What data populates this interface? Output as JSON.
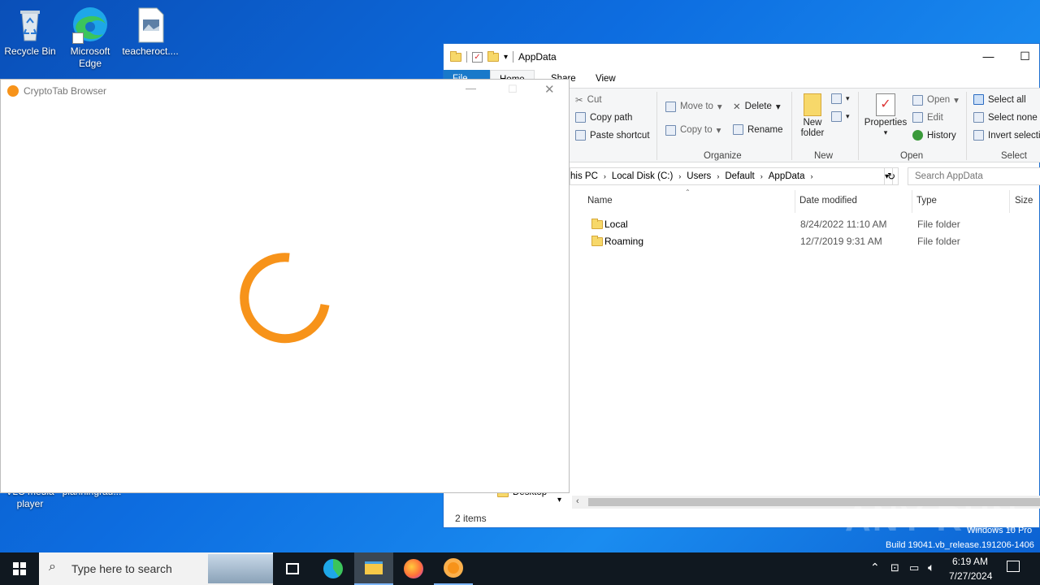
{
  "desktop": {
    "icons": [
      {
        "label": "Recycle Bin"
      },
      {
        "label": "Microsoft Edge"
      },
      {
        "label": "teacheroct...."
      },
      {
        "label": "VLC media player"
      },
      {
        "label": "planningrau..."
      }
    ]
  },
  "explorer": {
    "title": "AppData",
    "tabs": [
      "File",
      "Home",
      "Share",
      "View"
    ],
    "ribbon": {
      "clipboard": {
        "cut": "Cut",
        "copy_path": "Copy path",
        "paste_shortcut": "Paste shortcut"
      },
      "organize": {
        "move_to": "Move to",
        "copy_to": "Copy to",
        "delete": "Delete",
        "rename": "Rename",
        "label": "Organize"
      },
      "new": {
        "new_folder": "New folder",
        "label": "New"
      },
      "open": {
        "properties": "Properties",
        "open": "Open",
        "edit": "Edit",
        "history": "History",
        "label": "Open"
      },
      "select": {
        "select_all": "Select all",
        "select_none": "Select none",
        "invert": "Invert selecti",
        "label": "Select"
      }
    },
    "address": {
      "crumbs": [
        "his PC",
        "Local Disk (C:)",
        "Users",
        "Default",
        "AppData"
      ],
      "search_placeholder": "Search AppData"
    },
    "columns": [
      "Name",
      "Date modified",
      "Type",
      "Size"
    ],
    "files": [
      {
        "name": "Local",
        "modified": "8/24/2022 11:10 AM",
        "type": "File folder"
      },
      {
        "name": "Roaming",
        "modified": "12/7/2019 9:31 AM",
        "type": "File folder"
      }
    ],
    "nav_visible": "Desktop",
    "status": "2 items"
  },
  "crypto_window": {
    "title": "CryptoTab Browser",
    "accent": "#f7931a"
  },
  "watermark": {
    "text": "ANY RUN",
    "os": "Windows 10 Pro",
    "build": "Build 19041.vb_release.191206-1406"
  },
  "taskbar": {
    "search_placeholder": "Type here to search",
    "time": "6:19 AM",
    "date": "7/27/2024"
  }
}
